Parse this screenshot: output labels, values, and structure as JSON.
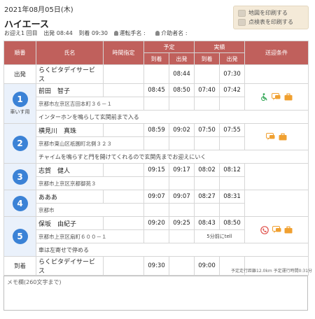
{
  "header": {
    "date": "2021年08月05日(木)",
    "vehicle": "ハイエース",
    "meta_passengers": "お迎え1 回目",
    "meta_depart": "出発 08:44",
    "meta_arrive": "到着 09:30",
    "meta_driver": "運転手名 :",
    "meta_helper": "介助者名 :"
  },
  "print": {
    "map_label": "地図を印刷する",
    "table_label": "点検表を印刷する"
  },
  "table": {
    "headers": {
      "order": "順番",
      "name": "氏名",
      "time_spec": "時間指定",
      "plan": "予定",
      "actual": "実績",
      "arrive": "到着",
      "depart": "出発",
      "conditions": "送迎条件"
    },
    "start": {
      "label": "出発",
      "name": "らくピタデイサービス",
      "plan_depart": "08:44",
      "actual_depart": "07:30"
    },
    "rows": [
      {
        "num": "1",
        "sub": "車いす用",
        "name": "前田　智子",
        "address": "京都市左京区吉田本町３６－１",
        "note": "インターホンを鳴らして玄関前まで入る",
        "plan_arrive": "08:45",
        "plan_depart": "08:50",
        "actual_arrive": "07:40",
        "actual_depart": "07:42",
        "extra": ""
      },
      {
        "num": "2",
        "sub": "",
        "name": "横見川　真珠",
        "address": "京都市東山区祇園町北側３２３",
        "note": "チャイムを鳴らすと門を開けてくれるので玄関先までお迎えにいく",
        "plan_arrive": "08:59",
        "plan_depart": "09:02",
        "actual_arrive": "07:50",
        "actual_depart": "07:55",
        "extra": ""
      },
      {
        "num": "3",
        "sub": "",
        "name": "志賀　健人",
        "address": "京都市上京区京都御苑３",
        "note": "",
        "plan_arrive": "09:15",
        "plan_depart": "09:17",
        "actual_arrive": "08:02",
        "actual_depart": "08:12",
        "extra": ""
      },
      {
        "num": "4",
        "sub": "",
        "name": "あああ",
        "address": "京都市",
        "note": "",
        "plan_arrive": "09:07",
        "plan_depart": "09:07",
        "actual_arrive": "08:27",
        "actual_depart": "08:31",
        "extra": ""
      },
      {
        "num": "5",
        "sub": "",
        "name": "保坂　由紀子",
        "address": "京都市上京区扇町６００－１",
        "note": "車は左寄せで停める",
        "plan_arrive": "09:20",
        "plan_depart": "09:25",
        "actual_arrive": "08:43",
        "actual_depart": "08:50",
        "extra": "5分前にtell"
      }
    ],
    "end": {
      "label": "到着",
      "name": "らくピタデイサービス",
      "plan_arrive": "09:30",
      "actual_arrive": "09:00"
    }
  },
  "stats": "予定走行距離12.0km 予定運行時間0:31分",
  "memo": {
    "placeholder": "メモ欄(260文字まで)"
  },
  "colors": {
    "header_bg": "#c0605c",
    "number_circle": "#3b82d6",
    "print_box": "#f4ead8",
    "icon_orange": "#f0a030",
    "icon_green": "#3aaa5c",
    "icon_red": "#e0504a"
  },
  "icons": [
    "person-icon",
    "printer-icon",
    "wheelchair-icon",
    "chat-icon",
    "bag-icon",
    "phone-icon"
  ]
}
